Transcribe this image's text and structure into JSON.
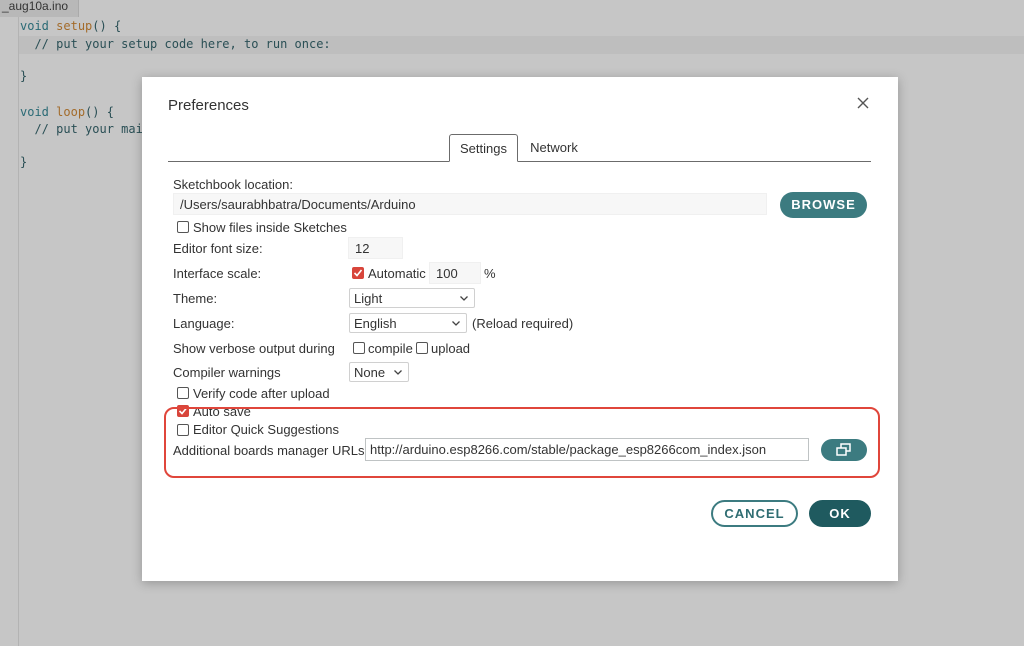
{
  "editor": {
    "tab_label": "_aug10a.ino",
    "lines": {
      "l1_kw": "void",
      "l1_fn": "setup",
      "l1_rest": "() {",
      "l2": "  // put your setup code here, to run once:",
      "l3": "}",
      "l4_kw": "void",
      "l4_fn": "loop",
      "l4_rest": "() {",
      "l5": "  // put your main",
      "l6": "}"
    }
  },
  "dialog": {
    "title": "Preferences",
    "tabs": {
      "settings": "Settings",
      "network": "Network"
    },
    "sketchbook": {
      "label": "Sketchbook location:",
      "value": "/Users/saurabhbatra/Documents/Arduino",
      "browse": "BROWSE"
    },
    "show_files": {
      "label": "Show files inside Sketches",
      "checked": false
    },
    "font_size": {
      "label": "Editor font size:",
      "value": "12"
    },
    "interface_scale": {
      "label": "Interface scale:",
      "auto_label": "Automatic",
      "auto_checked": true,
      "value": "100",
      "unit": "%"
    },
    "theme": {
      "label": "Theme:",
      "value": "Light"
    },
    "language": {
      "label": "Language:",
      "value": "English",
      "note": "(Reload required)"
    },
    "verbose": {
      "label": "Show verbose output during",
      "compile": "compile",
      "upload": "upload"
    },
    "warnings": {
      "label": "Compiler warnings",
      "value": "None"
    },
    "verify": {
      "label": "Verify code after upload",
      "checked": false
    },
    "auto_save": {
      "label": "Auto save",
      "checked": true
    },
    "quick_suggestions": {
      "label": "Editor Quick Suggestions",
      "checked": false
    },
    "boards_urls": {
      "label": "Additional boards manager URLs:",
      "value": "http://arduino.esp8266.com/stable/package_esp8266com_index.json"
    },
    "cancel": "CANCEL",
    "ok": "OK"
  },
  "colors": {
    "accent": "#3c7b80",
    "accent_dark": "#1f5a5f",
    "checked": "#d8453b",
    "highlight": "#e0463b"
  }
}
